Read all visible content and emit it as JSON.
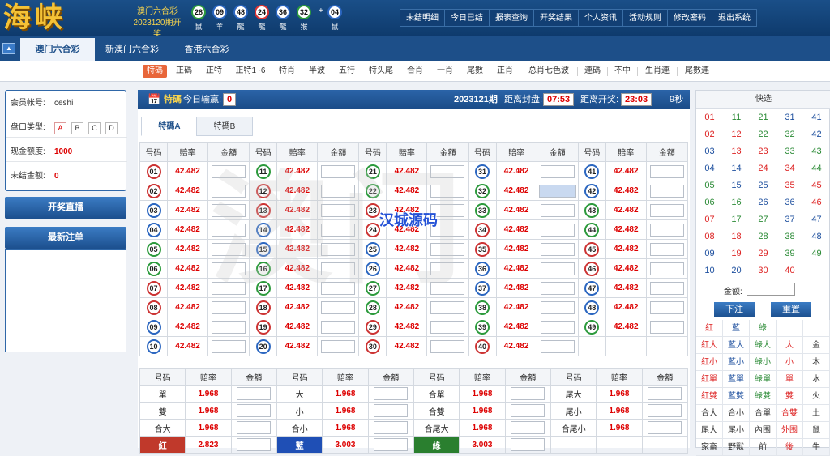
{
  "header": {
    "logo": "海峡",
    "lottery_name": "澳门六合彩",
    "draw_issue": "2023120期开奖",
    "balls": [
      {
        "num": "28",
        "zodiac": "鼠",
        "color": "#2c9a3c"
      },
      {
        "num": "09",
        "zodiac": "羊",
        "color": "#2b66c0"
      },
      {
        "num": "48",
        "zodiac": "龍",
        "color": "#2b66c0"
      },
      {
        "num": "24",
        "zodiac": "龍",
        "color": "#d33"
      },
      {
        "num": "36",
        "zodiac": "龍",
        "color": "#2b66c0"
      },
      {
        "num": "32",
        "zodiac": "猴",
        "color": "#2c9a3c"
      },
      {
        "num": "04",
        "zodiac": "鼠",
        "color": "#2b66c0"
      }
    ],
    "plus": "+",
    "nav": [
      "未结明细",
      "今日已结",
      "报表查询",
      "开奖结果",
      "个人资讯",
      "活动规则",
      "修改密码",
      "退出系统"
    ]
  },
  "lottery_tabs": [
    "澳门六合彩",
    "新澳门六合彩",
    "香港六合彩"
  ],
  "game_tabs": [
    "特碼",
    "正碼",
    "正特",
    "正特1~6",
    "特肖",
    "半波",
    "五行",
    "特头尾",
    "合肖",
    "一肖",
    "尾數",
    "正肖",
    "总肖七色波",
    "連碼",
    "不中",
    "生肖連",
    "尾數連"
  ],
  "account": {
    "member_label": "会员帐号:",
    "member": "ceshi",
    "plate_label": "盘口类型:",
    "plates": [
      "A",
      "B",
      "C",
      "D"
    ],
    "credit_label": "现金额度:",
    "credit": "1000",
    "unsettled_label": "未结金额:",
    "unsettled": "0"
  },
  "live_button": "开奖直播",
  "latest_orders": "最新注单",
  "main": {
    "section": "特碼",
    "today_label": "今日输赢:",
    "today_value": "0",
    "issue": "2023121期",
    "close_label": "距离封盘:",
    "close_time": "07:53",
    "open_label": "距离开奖:",
    "open_time": "23:03",
    "refresh": "9秒",
    "subtabs": [
      "特碼A",
      "特碼B"
    ],
    "col_headers": [
      "号码",
      "賠率",
      "金額"
    ],
    "odds": "42.482",
    "watermark": "汉城源码",
    "watermark_bg": "澳门"
  },
  "extras": {
    "headers": [
      "号码",
      "赔率",
      "金額"
    ],
    "rows": [
      [
        {
          "n": "單",
          "o": "1.968"
        },
        {
          "n": "大",
          "o": "1.968"
        },
        {
          "n": "合單",
          "o": "1.968"
        },
        {
          "n": "尾大",
          "o": "1.968"
        }
      ],
      [
        {
          "n": "雙",
          "o": "1.968"
        },
        {
          "n": "小",
          "o": "1.968"
        },
        {
          "n": "合雙",
          "o": "1.968"
        },
        {
          "n": "尾小",
          "o": "1.968"
        }
      ],
      [
        {
          "n": "合大",
          "o": "1.968"
        },
        {
          "n": "合小",
          "o": "1.968"
        },
        {
          "n": "合尾大",
          "o": "1.968"
        },
        {
          "n": "合尾小",
          "o": "1.968"
        }
      ],
      [
        {
          "n": "紅",
          "o": "2.823",
          "bg": "#c0392b"
        },
        {
          "n": "藍",
          "o": "3.003",
          "bg": "#1f4fb5"
        },
        {
          "n": "綠",
          "o": "3.003",
          "bg": "#2a7f2f"
        },
        {
          "n": "",
          "o": ""
        }
      ]
    ]
  },
  "quick": {
    "title": "快选",
    "amount_label": "金额:",
    "submit": "下注",
    "reset": "重置",
    "groups": [
      [
        "紅",
        "藍",
        "綠",
        "",
        ""
      ],
      [
        "紅大",
        "藍大",
        "綠大",
        "大",
        "金"
      ],
      [
        "紅小",
        "藍小",
        "綠小",
        "小",
        "木"
      ],
      [
        "紅單",
        "藍單",
        "綠單",
        "單",
        "水"
      ],
      [
        "紅雙",
        "藍雙",
        "綠雙",
        "雙",
        "火"
      ],
      [
        "合大",
        "合小",
        "合單",
        "合雙",
        "土"
      ],
      [
        "尾大",
        "尾小",
        "內围",
        "外围",
        "鼠"
      ],
      [
        "家畜",
        "野獸",
        "前",
        "後",
        "牛"
      ]
    ]
  }
}
